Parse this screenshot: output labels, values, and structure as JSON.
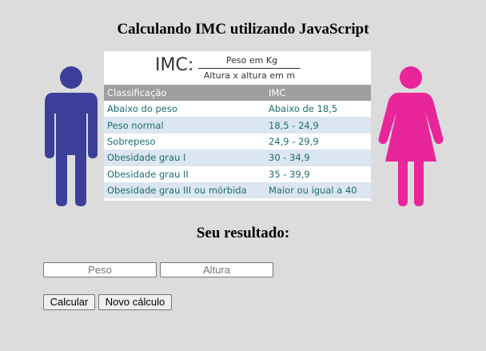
{
  "page": {
    "title": "Calculando IMC utilizando JavaScript",
    "result_heading": "Seu resultado:"
  },
  "formula": {
    "label": "IMC:",
    "numerator": "Peso em Kg",
    "denominator": "Altura x altura em m"
  },
  "table": {
    "headers": [
      "Classificação",
      "IMC"
    ],
    "rows": [
      [
        "Abaixo do peso",
        "Abaixo de 18,5"
      ],
      [
        "Peso normal",
        "18,5 - 24,9"
      ],
      [
        "Sobrepeso",
        "24,9 - 29,9"
      ],
      [
        "Obesidade grau I",
        "30 - 34,9"
      ],
      [
        "Obesidade grau II",
        "35 - 39,9"
      ],
      [
        "Obesidade grau III ou mórbida",
        "Maior ou igual a 40"
      ]
    ]
  },
  "form": {
    "peso": {
      "placeholder": "Peso",
      "value": ""
    },
    "altura": {
      "placeholder": "Altura",
      "value": ""
    },
    "calc_label": "Calcular",
    "new_label": "Novo cálculo"
  },
  "colors": {
    "male": "#3b3f99",
    "female": "#e8269a",
    "header_bg": "#9e9e9e",
    "row_alt": "#dce6f1",
    "row_text": "#1b6e6e"
  },
  "icons": {
    "male": "male-figure-icon",
    "female": "female-figure-icon"
  }
}
